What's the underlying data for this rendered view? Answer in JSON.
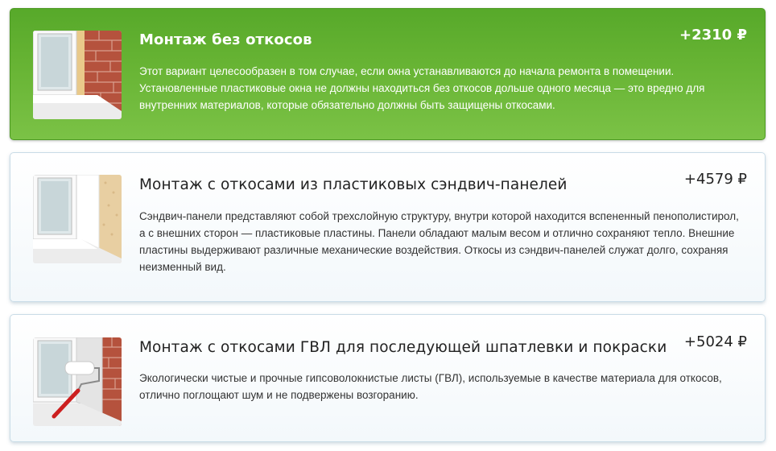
{
  "options": [
    {
      "title": "Монтаж без откосов",
      "price": "+2310 ₽",
      "description": "Этот вариант целесообразен в том случае, если окна устанавливаются до начала ремонта в помещении. Установленные пластиковые окна не должны находиться без откосов дольше одного месяца — это вредно для внутренних материалов, которые обязательно должны быть защищены откосами.",
      "image": "window-no-slopes-icon",
      "selected": true
    },
    {
      "title": "Монтаж с откосами из пластиковых сэндвич-панелей",
      "price": "+4579 ₽",
      "description": "Сэндвич-панели представляют собой трехслойную структуру, внутри которой находится вспененный пенополистирол, а с внешних сторон — пластиковые пластины. Панели обладают малым весом и отлично сохраняют тепло. Внешние пластины выдерживают различные механические воздействия. Откосы из сэндвич-панелей служат долго, сохраняя неизменный вид.",
      "image": "window-sandwich-panel-icon",
      "selected": false
    },
    {
      "title": "Монтаж с откосами ГВЛ для последующей шпатлевки и покраски",
      "price": "+5024 ₽",
      "description": "Экологически чистые и прочные гипсоволокнистые листы (ГВЛ), используемые в качестве материала для откосов, отлично поглощают шум и не подвержены возгоранию.",
      "image": "window-paint-roller-icon",
      "selected": false
    }
  ],
  "colors": {
    "selected_bg": "#66b333",
    "card_border": "#c9dce7",
    "text_dark": "#222222"
  }
}
